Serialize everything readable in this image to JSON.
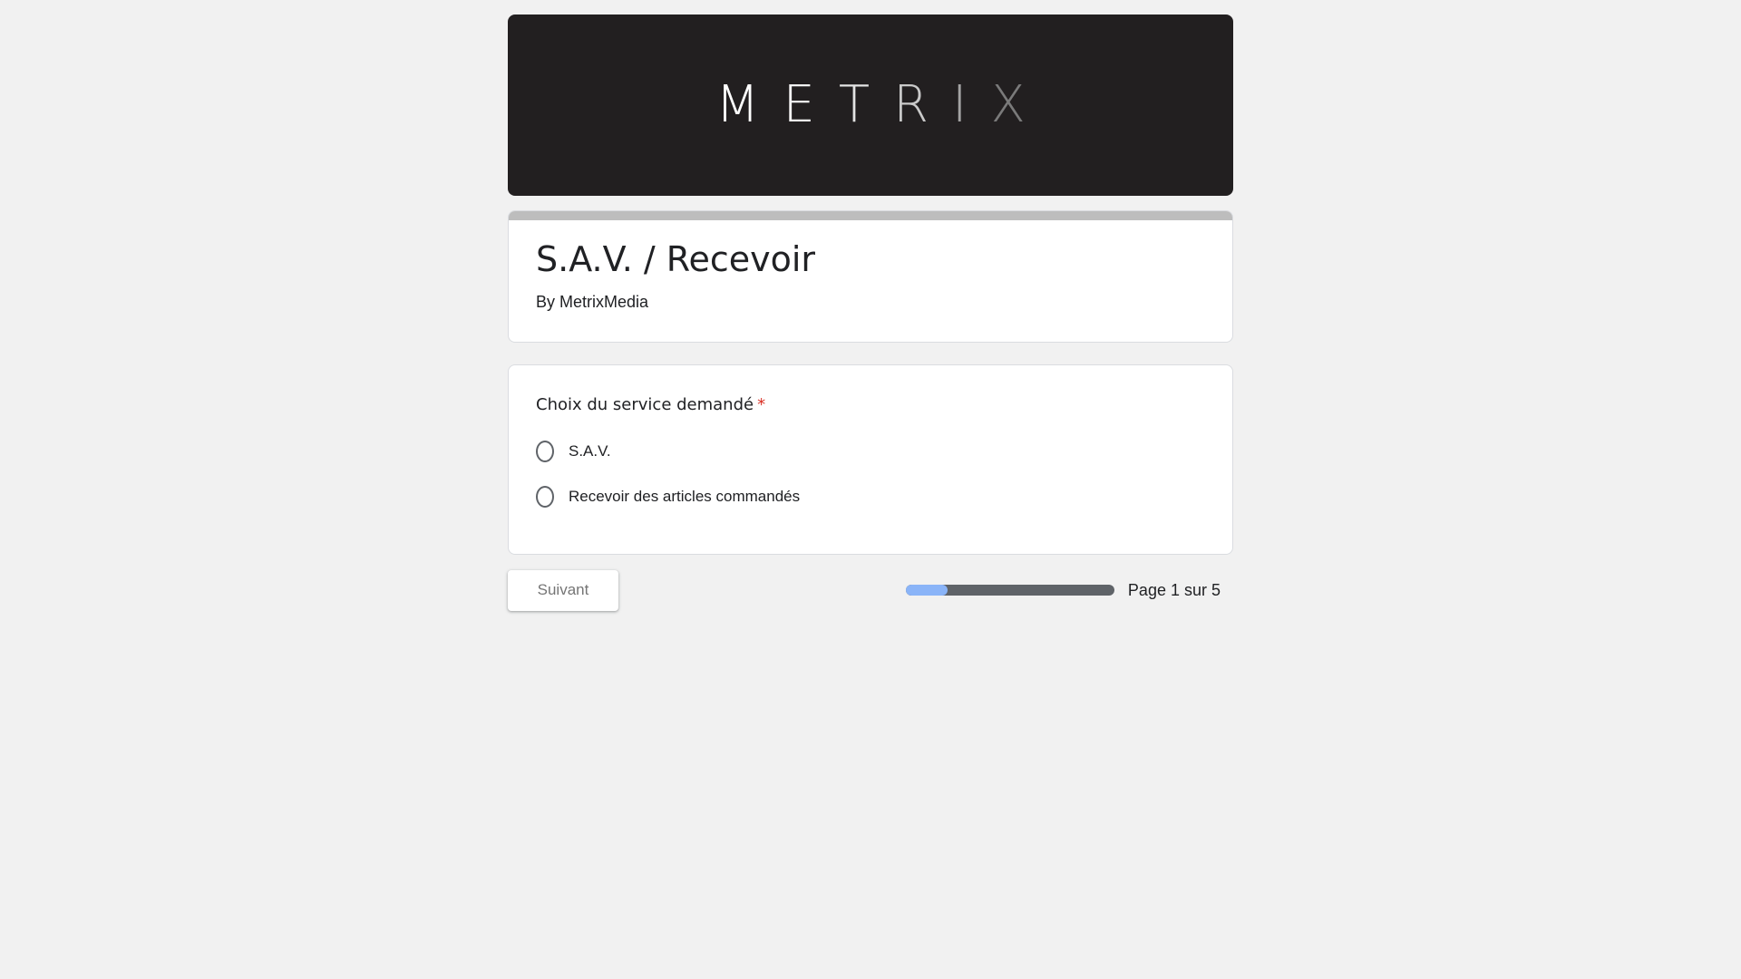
{
  "banner": {
    "logo_letters": [
      {
        "char": "M",
        "color": "#ffffff"
      },
      {
        "char": "E",
        "color": "#f2f2f2"
      },
      {
        "char": "T",
        "color": "#e3e3e3"
      },
      {
        "char": "R",
        "color": "#c9c9c9"
      },
      {
        "char": "I",
        "color": "#a3a3a3"
      },
      {
        "char": "X",
        "color": "#7a7a7a"
      }
    ],
    "background_color": "#221f20"
  },
  "form": {
    "title": "S.A.V. / Recevoir",
    "author": "By MetrixMedia",
    "accent_bar_color": "#bdbdbd"
  },
  "question": {
    "title": "Choix du service demandé",
    "required_marker": "*",
    "options": [
      {
        "label": "S.A.V.",
        "selected": false
      },
      {
        "label": "Recevoir des articles commandés",
        "selected": false
      }
    ]
  },
  "footer": {
    "next_label": "Suivant",
    "progress_fraction": 0.2,
    "progress_text": "Page 1 sur 5",
    "progress_fill_color": "#8ab4f8",
    "progress_track_color": "#5f6368"
  }
}
